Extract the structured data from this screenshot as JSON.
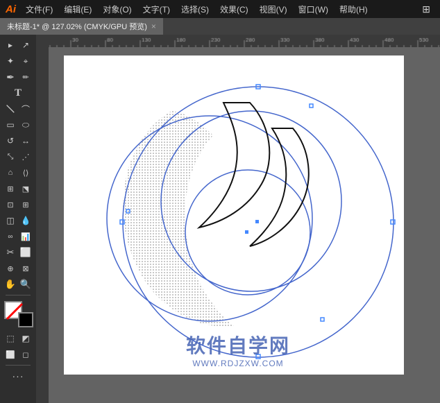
{
  "titlebar": {
    "logo": "Ai",
    "menus": [
      "文件(F)",
      "编辑(E)",
      "对象(O)",
      "文字(T)",
      "选择(S)",
      "效果(C)",
      "视图(V)",
      "窗口(W)",
      "帮助(H)"
    ]
  },
  "tab": {
    "title": "未标题-1* @ 127.02% (CMYK/GPU 预览)",
    "close": "×"
  },
  "tools": [
    {
      "icon": "▸",
      "name": "selection-tool"
    },
    {
      "icon": "↗",
      "name": "direct-selection-tool"
    },
    {
      "icon": "✏",
      "name": "pen-tool"
    },
    {
      "icon": "✒",
      "name": "curvature-tool"
    },
    {
      "icon": "T",
      "name": "type-tool"
    },
    {
      "icon": "\\",
      "name": "line-tool"
    },
    {
      "icon": "⬭",
      "name": "ellipse-tool"
    },
    {
      "icon": "⬜",
      "name": "rect-tool"
    },
    {
      "icon": "⟳",
      "name": "rotate-tool"
    },
    {
      "icon": "↔",
      "name": "reflect-tool"
    },
    {
      "icon": "S",
      "name": "scale-tool"
    },
    {
      "icon": "⌂",
      "name": "warp-tool"
    },
    {
      "icon": "⊞",
      "name": "shape-builder"
    },
    {
      "icon": "🪣",
      "name": "live-paint"
    },
    {
      "icon": "✂",
      "name": "scissors"
    },
    {
      "icon": "⊕",
      "name": "artboard-tool"
    },
    {
      "icon": "✋",
      "name": "hand-tool"
    },
    {
      "icon": "🔍",
      "name": "zoom-tool"
    }
  ],
  "watermark": {
    "main": "软件自学网",
    "sub": "WWW.RDJZXW.COM"
  },
  "colors": {
    "stroke_color": "#4466cc",
    "fill_dotted": "rgba(0,0,80,0.3)",
    "black_curves": "#1a1a1a",
    "selection_blue": "#4488ff"
  }
}
